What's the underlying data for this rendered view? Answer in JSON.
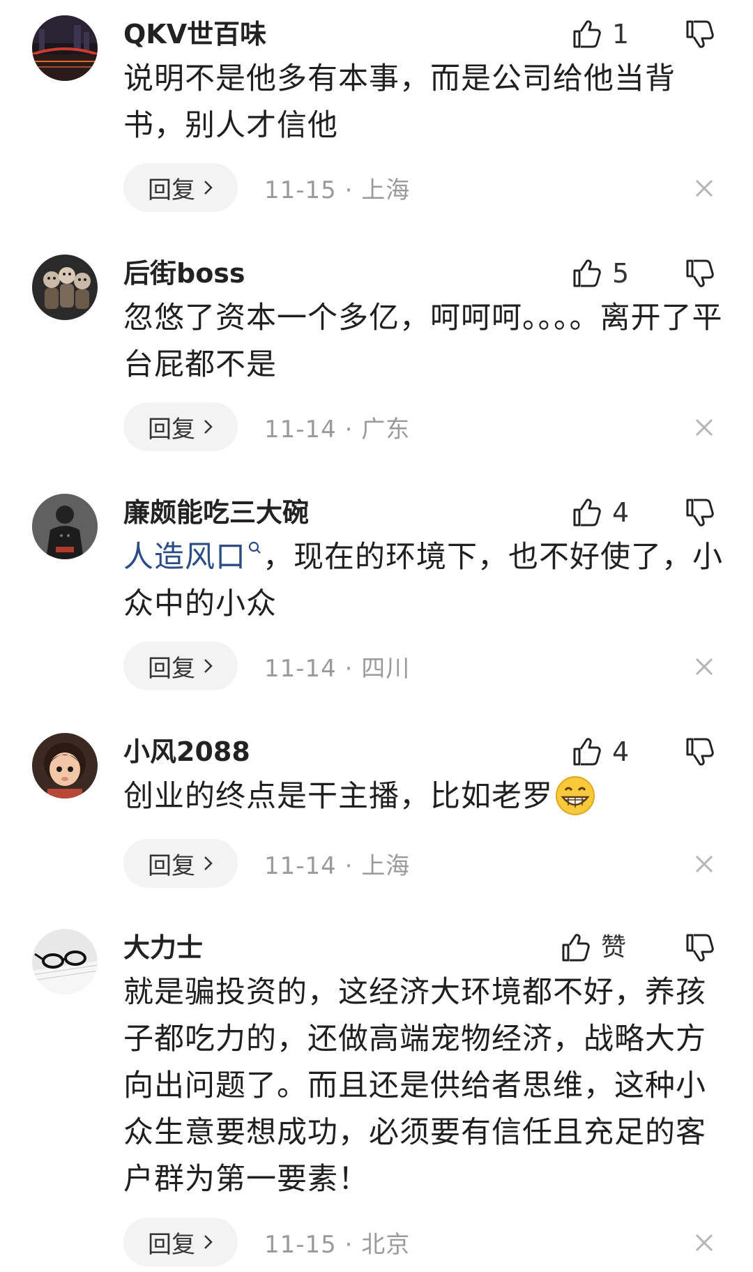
{
  "comments": [
    {
      "username": "QKV世百味",
      "likes": "1",
      "text": "说明不是他多有本事，而是公司给他当背书，别人才信他",
      "reply_label": "回复",
      "date": "11-15",
      "location": "上海",
      "avatar": "night-city-bridge-avatar"
    },
    {
      "username": "后街boss",
      "likes": "5",
      "text": "忽悠了资本一个多亿，呵呵呵。。。。离开了平台屁都不是",
      "reply_label": "回复",
      "date": "11-14",
      "location": "广东",
      "avatar": "cartoon-group-avatar"
    },
    {
      "username": "廉颇能吃三大碗",
      "likes": "4",
      "topic": "人造风口",
      "text": "，现在的环境下，也不好使了，小众中的小众",
      "reply_label": "回复",
      "date": "11-14",
      "location": "四川",
      "avatar": "soldier-avatar"
    },
    {
      "username": "小风2088",
      "likes": "4",
      "text": "创业的终点是干主播，比如老罗",
      "emoji": "grinning-face-emoji",
      "reply_label": "回复",
      "date": "11-14",
      "location": "上海",
      "avatar": "cartoon-girl-avatar"
    },
    {
      "username": "大力士",
      "likes": "赞",
      "text": "就是骗投资的，这经济大环境都不好，养孩子都吃力的，还做高端宠物经济，战略大方向出问题了。而且还是供给者思维，这种小众生意要想成功，必须要有信任且充足的客户群为第一要素！",
      "reply_label": "回复",
      "date": "11-15",
      "location": "北京",
      "avatar": "glasses-on-book-avatar"
    }
  ],
  "separator": "·",
  "colors": {
    "topic": "#2b4c86",
    "meta": "#9a9a9a",
    "reply_bg": "#f3f3f3"
  }
}
